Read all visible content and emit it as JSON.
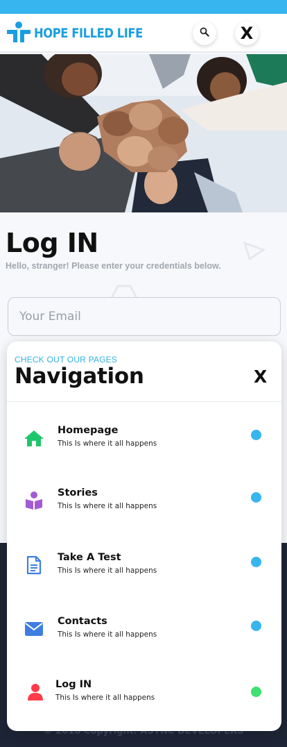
{
  "header": {
    "brand": "HOPE FILLED LIFE",
    "close_label": "X"
  },
  "login": {
    "title": "Log IN",
    "subtitle": "Hello, stranger! Please enter your credentials below.",
    "email_placeholder": "Your Email"
  },
  "footer": {
    "copyright": "© 2018 Copyright. ASYNC DEVELOPERS"
  },
  "nav_panel": {
    "kicker": "CHECK OUT OUR PAGES",
    "title": "Navigation",
    "close_label": "X",
    "items": [
      {
        "label": "Homepage",
        "description": "This Is where it all happens",
        "icon": "home-icon",
        "icon_color": "#1ec66b",
        "dot_color": "#37b5ee"
      },
      {
        "label": "Stories",
        "description": "This Is where it all happens",
        "icon": "book-reader-icon",
        "icon_color": "#a35bd0",
        "dot_color": "#37b5ee"
      },
      {
        "label": "Take A Test",
        "description": "This Is where it all happens",
        "icon": "document-icon",
        "icon_color": "#3f7ee0",
        "dot_color": "#37b5ee"
      },
      {
        "label": "Contacts",
        "description": "This Is where it all happens",
        "icon": "envelope-icon",
        "icon_color": "#3f7ee0",
        "dot_color": "#37b5ee"
      },
      {
        "label": "Log IN",
        "description": "This Is where it all happens",
        "icon": "user-icon",
        "icon_color": "#ff3b4a",
        "dot_color": "#3ee070"
      }
    ]
  },
  "colors": {
    "accent": "#37b5ee",
    "brand": "#1a9ee0",
    "footer_bg": "#1e2536"
  }
}
